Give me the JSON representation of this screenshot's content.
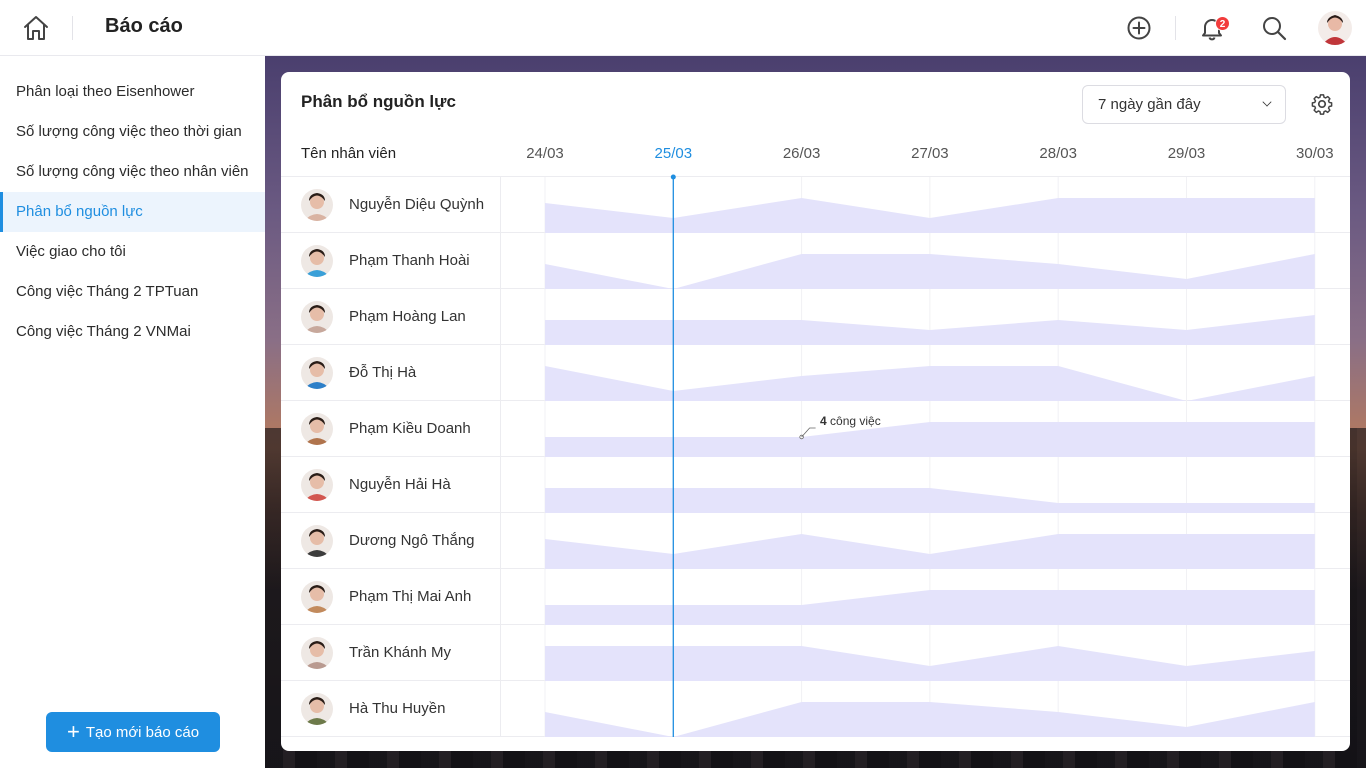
{
  "header": {
    "title": "Báo cáo",
    "notification_count": "2",
    "icons": [
      "home-icon",
      "add-circle-icon",
      "bell-icon",
      "search-icon",
      "user-avatar"
    ]
  },
  "sidebar": {
    "items": [
      {
        "label": "Phân loại theo Eisenhower",
        "active": false
      },
      {
        "label": "Số lượng công việc theo thời gian",
        "active": false
      },
      {
        "label": "Số lượng công việc theo nhân viên",
        "active": false
      },
      {
        "label": "Phân bổ nguồn lực",
        "active": true
      },
      {
        "label": "Việc giao cho tôi",
        "active": false
      },
      {
        "label": "Công việc Tháng 2 TPTuan",
        "active": false
      },
      {
        "label": "Công việc Tháng 2 VNMai",
        "active": false
      }
    ],
    "create_button": "Tạo mới báo cáo"
  },
  "report": {
    "title": "Phân bổ nguồn lực",
    "range_select": "7 ngày gần đây",
    "name_column": "Tên nhân viên",
    "today": "25/03",
    "tooltip": {
      "count": "4",
      "text": "công việc"
    }
  },
  "colors": {
    "accent": "#1f8ee0",
    "area_fill": "#e4e3fb",
    "badge": "#f23c3c"
  },
  "chart_data": {
    "type": "area",
    "x": [
      "24/03",
      "25/03",
      "26/03",
      "27/03",
      "28/03",
      "29/03",
      "30/03"
    ],
    "series": [
      {
        "name": "Nguyễn Diệu Quỳnh",
        "values": [
          6,
          3,
          7,
          3,
          7,
          7,
          7
        ]
      },
      {
        "name": "Phạm Thanh Hoài",
        "values": [
          5,
          0,
          7,
          7,
          5,
          2,
          7
        ]
      },
      {
        "name": "Phạm Hoàng Lan",
        "values": [
          5,
          5,
          5,
          3,
          5,
          3,
          6
        ]
      },
      {
        "name": "Đỗ Thị Hà",
        "values": [
          7,
          2,
          5,
          7,
          7,
          0,
          5
        ]
      },
      {
        "name": "Phạm Kiều Doanh",
        "values": [
          4,
          4,
          4,
          7,
          7,
          7,
          7
        ]
      },
      {
        "name": "Nguyễn Hải Hà",
        "values": [
          5,
          5,
          5,
          5,
          2,
          2,
          2
        ]
      },
      {
        "name": "Dương Ngô Thắng",
        "values": [
          6,
          3,
          7,
          3,
          7,
          7,
          7
        ]
      },
      {
        "name": "Phạm Thị Mai Anh",
        "values": [
          4,
          4,
          4,
          7,
          7,
          7,
          7
        ]
      },
      {
        "name": "Trần Khánh My",
        "values": [
          7,
          7,
          7,
          3,
          7,
          3,
          6
        ]
      },
      {
        "name": "Hà Thu Huyền",
        "values": [
          5,
          0,
          7,
          7,
          5,
          2,
          7
        ]
      }
    ],
    "ylim": [
      0,
      8
    ]
  }
}
